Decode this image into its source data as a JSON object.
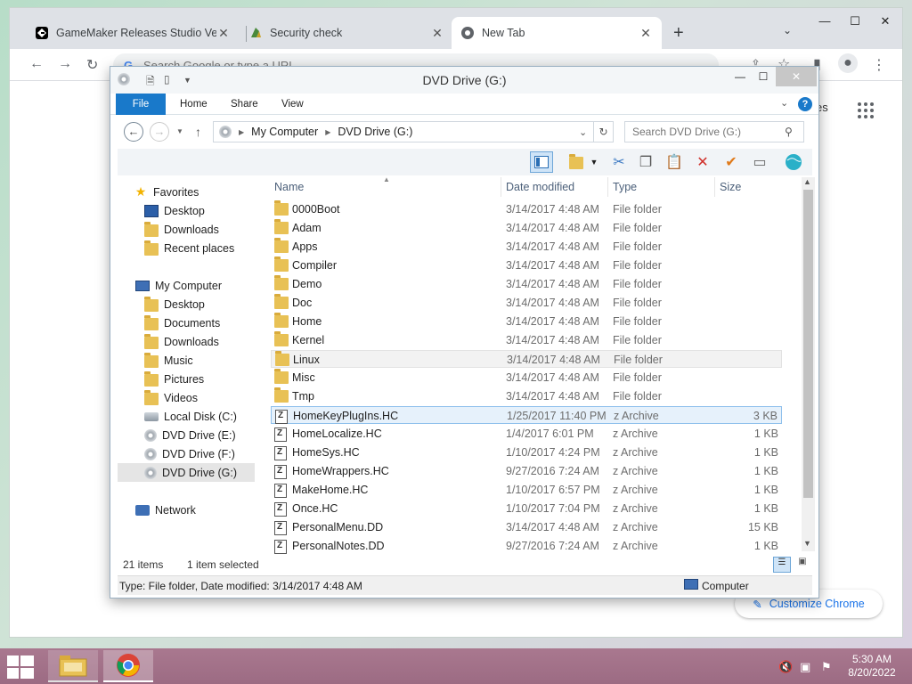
{
  "browser": {
    "tabs": [
      {
        "title": "GameMaker Releases Studio Vers",
        "icon": "gamemaker-icon"
      },
      {
        "title": "Security check",
        "icon": "security-check-icon"
      },
      {
        "title": "New Tab",
        "icon": "chrome-icon"
      }
    ],
    "omnibox_placeholder": "Search Google or type a URL",
    "ntp_right_text": "es",
    "customize_label": "Customize Chrome"
  },
  "explorer": {
    "title": "DVD Drive (G:)",
    "ribbon_tabs": [
      "File",
      "Home",
      "Share",
      "View"
    ],
    "breadcrumb": [
      "My Computer",
      "DVD Drive (G:)"
    ],
    "search_placeholder": "Search DVD Drive (G:)",
    "nav": {
      "favorites": {
        "label": "Favorites",
        "items": [
          "Desktop",
          "Downloads",
          "Recent places"
        ]
      },
      "computer": {
        "label": "My Computer",
        "items": [
          "Desktop",
          "Documents",
          "Downloads",
          "Music",
          "Pictures",
          "Videos",
          "Local Disk (C:)",
          "DVD Drive (E:)",
          "DVD Drive (F:)",
          "DVD Drive (G:)"
        ]
      },
      "network": {
        "label": "Network"
      }
    },
    "columns": {
      "name": "Name",
      "date": "Date modified",
      "type": "Type",
      "size": "Size"
    },
    "rows": [
      {
        "name": "0000Boot",
        "date": "3/14/2017 4:48 AM",
        "type": "File folder",
        "size": "",
        "kind": "folder"
      },
      {
        "name": "Adam",
        "date": "3/14/2017 4:48 AM",
        "type": "File folder",
        "size": "",
        "kind": "folder"
      },
      {
        "name": "Apps",
        "date": "3/14/2017 4:48 AM",
        "type": "File folder",
        "size": "",
        "kind": "folder"
      },
      {
        "name": "Compiler",
        "date": "3/14/2017 4:48 AM",
        "type": "File folder",
        "size": "",
        "kind": "folder"
      },
      {
        "name": "Demo",
        "date": "3/14/2017 4:48 AM",
        "type": "File folder",
        "size": "",
        "kind": "folder"
      },
      {
        "name": "Doc",
        "date": "3/14/2017 4:48 AM",
        "type": "File folder",
        "size": "",
        "kind": "folder"
      },
      {
        "name": "Home",
        "date": "3/14/2017 4:48 AM",
        "type": "File folder",
        "size": "",
        "kind": "folder"
      },
      {
        "name": "Kernel",
        "date": "3/14/2017 4:48 AM",
        "type": "File folder",
        "size": "",
        "kind": "folder"
      },
      {
        "name": "Linux",
        "date": "3/14/2017 4:48 AM",
        "type": "File folder",
        "size": "",
        "kind": "folder"
      },
      {
        "name": "Misc",
        "date": "3/14/2017 4:48 AM",
        "type": "File folder",
        "size": "",
        "kind": "folder"
      },
      {
        "name": "Tmp",
        "date": "3/14/2017 4:48 AM",
        "type": "File folder",
        "size": "",
        "kind": "folder"
      },
      {
        "name": "HomeKeyPlugIns.HC",
        "date": "1/25/2017 11:40 PM",
        "type": "z Archive",
        "size": "3 KB",
        "kind": "file"
      },
      {
        "name": "HomeLocalize.HC",
        "date": "1/4/2017 6:01 PM",
        "type": "z Archive",
        "size": "1 KB",
        "kind": "file"
      },
      {
        "name": "HomeSys.HC",
        "date": "1/10/2017 4:24 PM",
        "type": "z Archive",
        "size": "1 KB",
        "kind": "file"
      },
      {
        "name": "HomeWrappers.HC",
        "date": "9/27/2016 7:24 AM",
        "type": "z Archive",
        "size": "1 KB",
        "kind": "file"
      },
      {
        "name": "MakeHome.HC",
        "date": "1/10/2017 6:57 PM",
        "type": "z Archive",
        "size": "1 KB",
        "kind": "file"
      },
      {
        "name": "Once.HC",
        "date": "1/10/2017 7:04 PM",
        "type": "z Archive",
        "size": "1 KB",
        "kind": "file"
      },
      {
        "name": "PersonalMenu.DD",
        "date": "3/14/2017 4:48 AM",
        "type": "z Archive",
        "size": "15 KB",
        "kind": "file"
      },
      {
        "name": "PersonalNotes.DD",
        "date": "9/27/2016 7:24 AM",
        "type": "z Archive",
        "size": "1 KB",
        "kind": "file"
      }
    ],
    "hover_row": "Linux",
    "selected_row": "HomeKeyPlugIns.HC",
    "status": {
      "count": "21 items",
      "selection": "1 item selected"
    },
    "details": {
      "text": "Type: File folder, Date modified: 3/14/2017 4:48 AM",
      "location": "Computer"
    }
  },
  "taskbar": {
    "time": "5:30 AM",
    "date": "8/20/2022"
  }
}
